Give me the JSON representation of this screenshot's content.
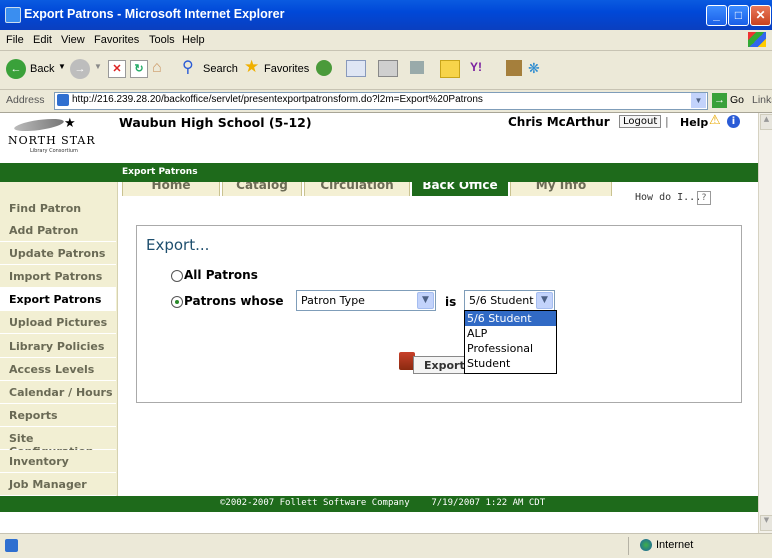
{
  "window": {
    "title": "Export Patrons - Microsoft Internet Explorer"
  },
  "menu": [
    "File",
    "Edit",
    "View",
    "Favorites",
    "Tools",
    "Help"
  ],
  "toolbar": {
    "back": "Back",
    "search": "Search",
    "favorites": "Favorites"
  },
  "address": {
    "label": "Address",
    "url": "http://216.239.28.20/backoffice/servlet/presentexportpatronsform.do?l2m=Export%20Patrons",
    "go": "Go",
    "links": "Links"
  },
  "header": {
    "logo_top": "NORTH STAR",
    "logo_sub": "Library Consortium",
    "school": "Waubun High School (5-12)",
    "user": "Chris McArthur",
    "logout": "Logout",
    "help": "Help"
  },
  "tabs": [
    "Home",
    "Catalog",
    "Circulation",
    "Back Office",
    "My Info"
  ],
  "active_tab": "Back Office",
  "breadcrumb": "Export Patrons",
  "sidebar": [
    "Find Patron",
    "Add Patron",
    "Update Patrons",
    "Import Patrons",
    "Export Patrons",
    "Upload Pictures",
    "Library Policies",
    "Access Levels",
    "Calendar / Hours",
    "Reports",
    "Site Configuration",
    "Inventory",
    "Job Manager"
  ],
  "howdoi": "How do I...",
  "howdoi_icon": "?",
  "form": {
    "title": "Export...",
    "option_all": "All Patrons",
    "option_whose": "Patrons whose",
    "field_select": "Patron Type",
    "is_label": "is",
    "value_select": "5/6 Student",
    "dropdown_options": [
      "5/6 Student",
      "ALP",
      "Professional",
      "Student"
    ],
    "export_button": "Export"
  },
  "footer": "©2002-2007 Follett Software Company    7/19/2007 1:22 AM CDT",
  "status": {
    "zone": "Internet"
  },
  "colors": {
    "brand_green": "#1e6a1b",
    "sidebar_bg": "#f2efd3",
    "title_blue": "#0048d8"
  }
}
